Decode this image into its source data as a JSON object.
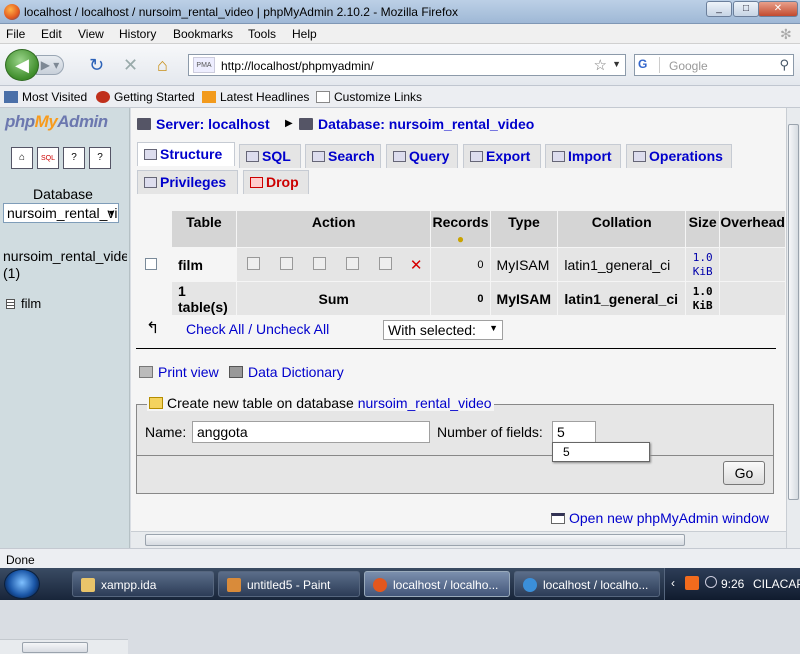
{
  "window": {
    "title": "localhost / localhost / nursoim_rental_video | phpMyAdmin 2.10.2 - Mozilla Firefox",
    "minimize": "_",
    "maximize": "□",
    "close": "✕"
  },
  "menu": [
    "File",
    "Edit",
    "View",
    "History",
    "Bookmarks",
    "Tools",
    "Help"
  ],
  "nav": {
    "url": "http://localhost/phpmyadmin/",
    "url_site_badge": "PMA",
    "search_engine_badge": "G",
    "search_placeholder": "Google"
  },
  "bookmarks": [
    "Most Visited",
    "Getting Started",
    "Latest Headlines",
    "Customize Links"
  ],
  "left": {
    "logo": {
      "php": "php",
      "my": "My",
      "admin": "Admin"
    },
    "buttons": [
      "home",
      "sql",
      "docs",
      "query"
    ],
    "sql_badge": "SQL",
    "db_label": "Database",
    "db_select": "nursoim_rental_video",
    "db_name_line1": "nursoim_rental_video",
    "db_name_line2": "(1)",
    "table_link": "film"
  },
  "breadcrumb": {
    "server": "Server: localhost",
    "separator": "▶",
    "database": "Database: nursoim_rental_video"
  },
  "tabs": [
    "Structure",
    "SQL",
    "Search",
    "Query",
    "Export",
    "Import",
    "Operations",
    "Privileges",
    "Drop"
  ],
  "table": {
    "headers": {
      "table": "Table",
      "action": "Action",
      "records": "Records",
      "type": "Type",
      "collation": "Collation",
      "size": "Size",
      "overhead": "Overhead"
    },
    "rows": [
      {
        "name": "film",
        "records": "0",
        "type": "MyISAM",
        "collation": "latin1_general_ci",
        "size_value": "1.0",
        "size_unit": "KiB"
      }
    ],
    "summary": {
      "count": "1 table(s)",
      "sum": "Sum",
      "records": "0",
      "type": "MyISAM",
      "collation": "latin1_general_ci",
      "size_value": "1.0",
      "size_unit": "KiB"
    }
  },
  "bulk": {
    "check_all": "Check All",
    "separator": " / ",
    "uncheck_all": "Uncheck All",
    "with_selected": "With selected:"
  },
  "links": {
    "print_view": "Print view",
    "data_dictionary": "Data Dictionary"
  },
  "create": {
    "legend_prefix": "Create new table on database ",
    "legend_db": "nursoim_rental_video",
    "name_label": "Name:",
    "name_value": "anggota",
    "fields_label": "Number of fields:",
    "fields_value": "5",
    "autocomplete_option": "5",
    "go": "Go"
  },
  "open_new_window": "Open new phpMyAdmin window",
  "status": "Done",
  "taskbar": {
    "tasks": [
      "xampp.ida",
      "untitled5 - Paint",
      "localhost / localho...",
      "localhost / localho..."
    ],
    "clock": "9:26",
    "locale": "CILACAP"
  },
  "colors": {
    "link": "#0000cc",
    "drop": "#cc0000",
    "left_frame": "#d0dce0",
    "header_cell": "#d5d5d5",
    "row_cell": "#e5e5e5"
  }
}
